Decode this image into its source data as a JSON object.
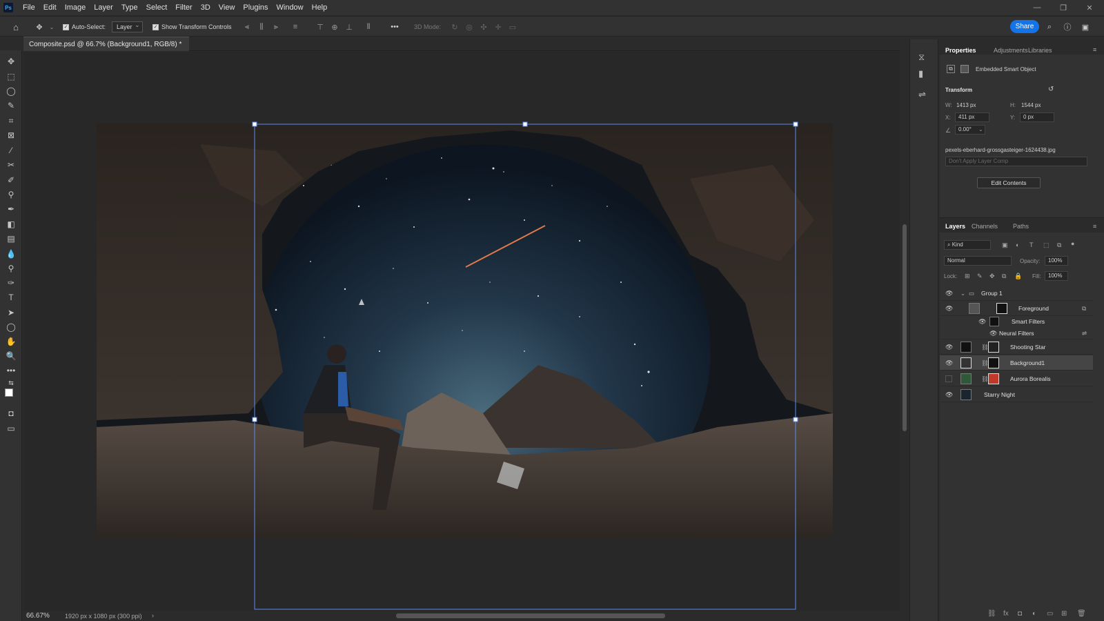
{
  "app": {
    "logo": "Ps"
  },
  "menu": [
    "File",
    "Edit",
    "Image",
    "Layer",
    "Type",
    "Select",
    "Filter",
    "3D",
    "View",
    "Plugins",
    "Window",
    "Help"
  ],
  "window_controls": {
    "minimize": "—",
    "restore": "❐",
    "close": "✕"
  },
  "options_bar": {
    "auto_select_label": "Auto-Select:",
    "auto_select_value": "Layer",
    "show_transform_label": "Show Transform Controls",
    "mode_3d_label": "3D Mode:",
    "more_label": "•••",
    "share_label": "Share"
  },
  "document": {
    "tab_title": "Composite.psd @ 66.7% (Background1, RGB/8) *",
    "close_glyph": "×",
    "zoom": "66.67%",
    "dimensions": "1920 px x 1080 px (300 ppi)"
  },
  "properties": {
    "tabs": [
      "Properties",
      "Adjustments",
      "Libraries"
    ],
    "type_label": "Embedded Smart Object",
    "transform_label": "Transform",
    "w_label": "W:",
    "w_value": "1413 px",
    "h_label": "H:",
    "h_value": "1544 px",
    "x_label": "X:",
    "x_value": "411 px",
    "y_label": "Y:",
    "y_value": "0 px",
    "angle_value": "0.00°",
    "filename": "pexels-eberhard-grossgasteiger-1624438.jpg",
    "layer_comp_placeholder": "Don't Apply Layer Comp",
    "edit_contents_label": "Edit Contents"
  },
  "layers_panel": {
    "tabs": [
      "Layers",
      "Channels",
      "Paths"
    ],
    "filter_kind": "Kind",
    "blend_mode": "Normal",
    "opacity_label": "Opacity:",
    "opacity_value": "100%",
    "lock_label": "Lock:",
    "fill_label": "Fill:",
    "fill_value": "100%",
    "layers": [
      {
        "name": "Group 1",
        "visible": true
      },
      {
        "name": "Foreground",
        "visible": true
      },
      {
        "name": "Smart Filters",
        "visible": true
      },
      {
        "name": "Neural Filters",
        "visible": true
      },
      {
        "name": "Shooting Star",
        "visible": true
      },
      {
        "name": "Background1",
        "visible": true,
        "selected": true
      },
      {
        "name": "Aurora Borealis",
        "visible": false
      },
      {
        "name": "Starry Night",
        "visible": true
      }
    ]
  },
  "colors": {
    "accent": "#1473e6",
    "selection": "#5b8def",
    "bg": "#282828",
    "panel": "#323232"
  }
}
